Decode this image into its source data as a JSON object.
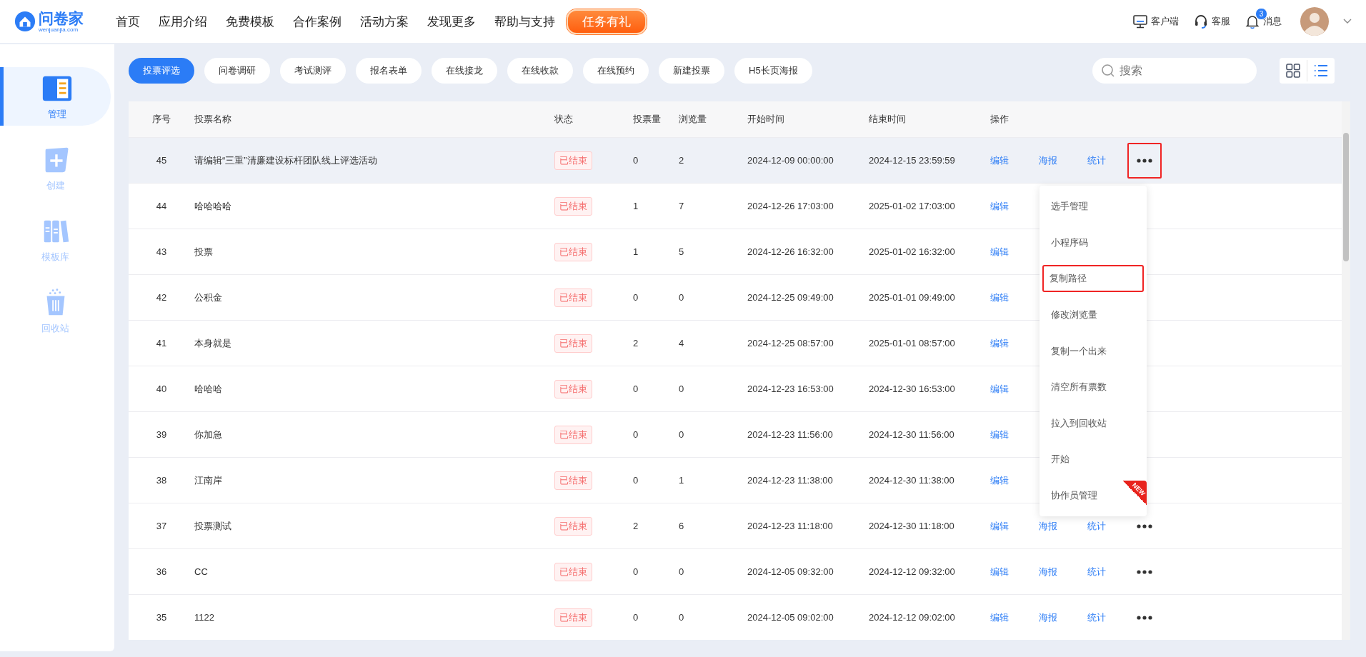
{
  "header": {
    "logo": {
      "name": "问卷家",
      "domain": "wenjuanjia.com"
    },
    "nav": [
      "首页",
      "应用介绍",
      "免费模板",
      "合作案例",
      "活动方案",
      "发现更多",
      "帮助与支持"
    ],
    "promo_button": "任务有礼",
    "tools": [
      {
        "kind": "desktop",
        "label": "客户端"
      },
      {
        "kind": "headset",
        "label": "客服"
      },
      {
        "kind": "bell",
        "label": "消息",
        "badge": "3"
      }
    ]
  },
  "sidebar": {
    "items": [
      {
        "kind": "manage",
        "label": "管理",
        "selected": true
      },
      {
        "kind": "create",
        "label": "创建",
        "selected": false
      },
      {
        "kind": "templates",
        "label": "模板库",
        "selected": false
      },
      {
        "kind": "trash",
        "label": "回收站",
        "selected": false
      }
    ]
  },
  "tabs": [
    {
      "label": "投票评选",
      "selected": true
    },
    {
      "label": "问卷调研",
      "selected": false
    },
    {
      "label": "考试测评",
      "selected": false
    },
    {
      "label": "报名表单",
      "selected": false
    },
    {
      "label": "在线接龙",
      "selected": false
    },
    {
      "label": "在线收款",
      "selected": false
    },
    {
      "label": "在线预约",
      "selected": false
    },
    {
      "label": "新建投票",
      "selected": false
    },
    {
      "label": "H5长页海报",
      "selected": false
    }
  ],
  "search": {
    "placeholder": "搜索"
  },
  "view_toggle": [
    {
      "kind": "grid",
      "selected": false
    },
    {
      "kind": "list",
      "selected": true
    }
  ],
  "table": {
    "columns": [
      "序号",
      "投票名称",
      "状态",
      "投票量",
      "浏览量",
      "开始时间",
      "结束时间",
      "操作"
    ],
    "rows": [
      {
        "no": "45",
        "name": "请编辑“三重”清廉建设标杆团队线上评选活动",
        "status": "已结束",
        "votes": "0",
        "views": "2",
        "start": "2024-12-09 00:00:00",
        "end": "2024-12-15 23:59:59",
        "actions": [
          "编辑",
          "海报",
          "统计"
        ],
        "more": true,
        "selected": true
      },
      {
        "no": "44",
        "name": "哈哈哈哈",
        "status": "已结束",
        "votes": "1",
        "views": "7",
        "start": "2024-12-26 17:03:00",
        "end": "2025-01-02 17:03:00",
        "actions": [
          "编辑"
        ],
        "more": false,
        "selected": false
      },
      {
        "no": "43",
        "name": "投票",
        "status": "已结束",
        "votes": "1",
        "views": "5",
        "start": "2024-12-26 16:32:00",
        "end": "2025-01-02 16:32:00",
        "actions": [
          "编辑"
        ],
        "more": false,
        "selected": false
      },
      {
        "no": "42",
        "name": "公积金",
        "status": "已结束",
        "votes": "0",
        "views": "0",
        "start": "2024-12-25 09:49:00",
        "end": "2025-01-01 09:49:00",
        "actions": [
          "编辑"
        ],
        "more": false,
        "selected": false
      },
      {
        "no": "41",
        "name": "本身就是",
        "status": "已结束",
        "votes": "2",
        "views": "4",
        "start": "2024-12-25 08:57:00",
        "end": "2025-01-01 08:57:00",
        "actions": [
          "编辑"
        ],
        "more": false,
        "selected": false
      },
      {
        "no": "40",
        "name": "哈哈哈",
        "status": "已结束",
        "votes": "0",
        "views": "0",
        "start": "2024-12-23 16:53:00",
        "end": "2024-12-30 16:53:00",
        "actions": [
          "编辑"
        ],
        "more": false,
        "selected": false
      },
      {
        "no": "39",
        "name": "你加急",
        "status": "已结束",
        "votes": "0",
        "views": "0",
        "start": "2024-12-23 11:56:00",
        "end": "2024-12-30 11:56:00",
        "actions": [
          "编辑"
        ],
        "more": false,
        "selected": false
      },
      {
        "no": "38",
        "name": "江南岸",
        "status": "已结束",
        "votes": "0",
        "views": "1",
        "start": "2024-12-23 11:38:00",
        "end": "2024-12-30 11:38:00",
        "actions": [
          "编辑"
        ],
        "more": false,
        "selected": false
      },
      {
        "no": "37",
        "name": "投票测试",
        "status": "已结束",
        "votes": "2",
        "views": "6",
        "start": "2024-12-23 11:18:00",
        "end": "2024-12-30 11:18:00",
        "actions": [
          "编辑",
          "海报",
          "统计"
        ],
        "more": true,
        "selected": false
      },
      {
        "no": "36",
        "name": "CC",
        "status": "已结束",
        "votes": "0",
        "views": "0",
        "start": "2024-12-05 09:32:00",
        "end": "2024-12-12 09:32:00",
        "actions": [
          "编辑",
          "海报",
          "统计"
        ],
        "more": true,
        "selected": false
      },
      {
        "no": "35",
        "name": "1122",
        "status": "已结束",
        "votes": "0",
        "views": "0",
        "start": "2024-12-05 09:02:00",
        "end": "2024-12-12 09:02:00",
        "actions": [
          "编辑",
          "海报",
          "统计"
        ],
        "more": true,
        "selected": false
      }
    ]
  },
  "more_menu": {
    "items": [
      {
        "label": "选手管理",
        "highlighted": false
      },
      {
        "label": "小程序码",
        "highlighted": false
      },
      {
        "label": "复制路径",
        "highlighted": true
      },
      {
        "label": "修改浏览量",
        "highlighted": false
      },
      {
        "label": "复制一个出来",
        "highlighted": false
      },
      {
        "label": "清空所有票数",
        "highlighted": false
      },
      {
        "label": "拉入到回收站",
        "highlighted": false
      },
      {
        "label": "开始",
        "highlighted": false
      },
      {
        "label": "协作员管理",
        "highlighted": false,
        "badge": "NEW"
      }
    ]
  }
}
